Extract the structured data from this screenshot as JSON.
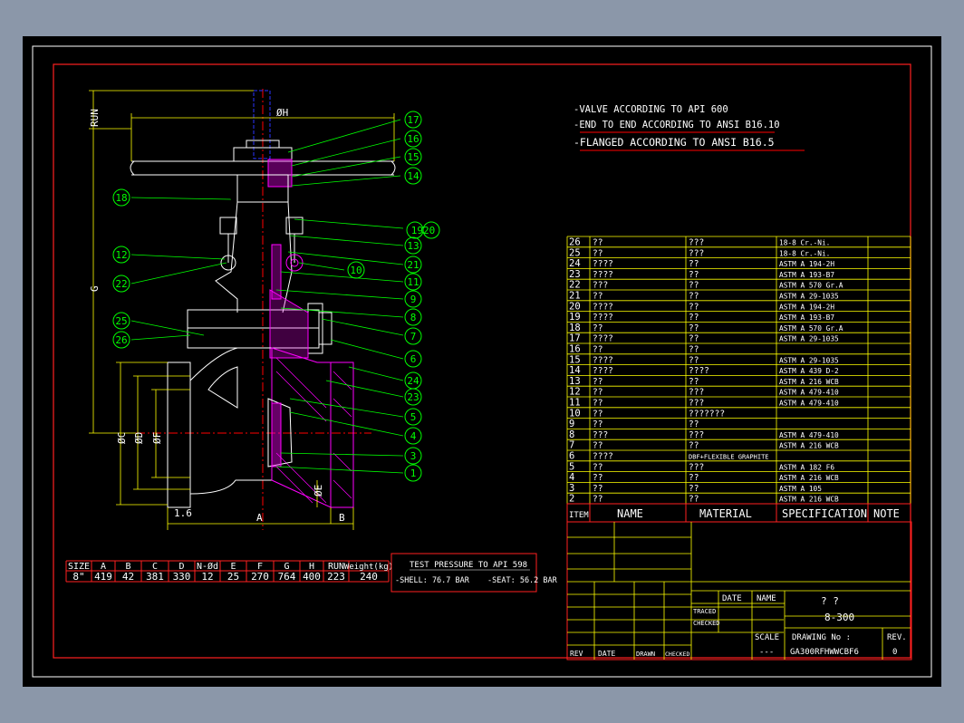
{
  "colors": {
    "outer_bg": "#8b97a9",
    "sheet_bg": "#000000",
    "border": "#ff2020",
    "frame": "#ffffff",
    "text": "#ffffff",
    "yellow": "#ffff00",
    "green": "#00ff00",
    "red": "#ff0000",
    "magenta": "#ff00ff",
    "blue": "#2b33ff"
  },
  "notes": [
    "-VALVE ACCORDING TO API 600",
    "-END TO END ACCORDING TO ANSI B16.10",
    "-FLANGED ACCORDING TO ANSI B16.5"
  ],
  "dims": {
    "run": "RUN",
    "oh": "ØH",
    "g": "G",
    "oc": "ØC",
    "od": "ØD",
    "of": "ØF",
    "oe": "ØE",
    "a": "A",
    "b": "B",
    "t": "1.6"
  },
  "balloons": [
    "17",
    "16",
    "15",
    "14",
    "18",
    "1920",
    "13",
    "12",
    "21",
    "10",
    "11",
    "22",
    "9",
    "8",
    "25",
    "7",
    "26",
    "6",
    "24",
    "23",
    "5",
    "4",
    "3",
    "1"
  ],
  "size_table": {
    "headers": [
      "SIZE",
      "A",
      "B",
      "C",
      "D",
      "N-Ød",
      "E",
      "F",
      "G",
      "H",
      "RUN",
      "Weight(kg)"
    ],
    "values": [
      "8\"",
      "419",
      "42",
      "381",
      "330",
      "12",
      "25",
      "270",
      "764",
      "400",
      "223",
      "240"
    ]
  },
  "test": {
    "title": "TEST PRESSURE TO API 598",
    "shell": "-SHELL: 76.7 BAR",
    "seat": "-SEAT: 56.2 BAR"
  },
  "parts": [
    [
      "26",
      "??",
      "???",
      "18-8 Cr.-Ni.",
      ""
    ],
    [
      "25",
      "??",
      "???",
      "18-8 Cr.-Ni.",
      ""
    ],
    [
      "24",
      "????",
      "??",
      "ASTM A 194-2H",
      ""
    ],
    [
      "23",
      "????",
      "??",
      "ASTM A 193-B7",
      ""
    ],
    [
      "22",
      "???",
      "??",
      "ASTM A 570 Gr.A",
      ""
    ],
    [
      "21",
      "??",
      "??",
      "ASTM A 29-1035",
      ""
    ],
    [
      "20",
      "????",
      "??",
      "ASTM A 194-2H",
      ""
    ],
    [
      "19",
      "????",
      "??",
      "ASTM A 193-B7",
      ""
    ],
    [
      "18",
      "??",
      "??",
      "ASTM A 570 Gr.A",
      ""
    ],
    [
      "17",
      "????",
      "??",
      "ASTM A 29-1035",
      ""
    ],
    [
      "16",
      "??",
      "??",
      "",
      ""
    ],
    [
      "15",
      "????",
      "??",
      "ASTM A 29-1035",
      ""
    ],
    [
      "14",
      "????",
      "????",
      "ASTM A 439 D-2",
      ""
    ],
    [
      "13",
      "??",
      "??",
      "ASTM A 216 WCB",
      ""
    ],
    [
      "12",
      "??",
      "???",
      "ASTM A 479-410",
      ""
    ],
    [
      "11",
      "??",
      "???",
      "ASTM A 479-410",
      ""
    ],
    [
      "10",
      "??",
      "???????",
      "",
      ""
    ],
    [
      "9",
      "??",
      "??",
      "",
      ""
    ],
    [
      "8",
      "???",
      "???",
      "ASTM A 479-410",
      ""
    ],
    [
      "7",
      "??",
      "??",
      "ASTM A 216 WCB",
      ""
    ],
    [
      "6",
      "????",
      "DBF+FLEXIBLE GRAPHITE",
      "",
      ""
    ],
    [
      "5",
      "??",
      "???",
      "ASTM A 182 F6",
      ""
    ],
    [
      "4",
      "??",
      "??",
      "ASTM A 216 WCB",
      ""
    ],
    [
      "3",
      "??",
      "??",
      "ASTM A 105",
      ""
    ],
    [
      "2",
      "??",
      "??",
      "ASTM A 216 WCB",
      ""
    ]
  ],
  "parts_header": {
    "item": "ITEM",
    "name": "NAME",
    "material": "MATERIAL",
    "spec": "SPECIFICATION",
    "note": "NOTE"
  },
  "title_block": {
    "date": "DATE",
    "name": "NAME",
    "traced": "TRACED",
    "checked": "CHECKED",
    "title_q": "?   ?",
    "class": "8-300",
    "scale_label": "SCALE",
    "scale_value": "---",
    "drawing_label": "DRAWING No :",
    "drawing_no": "GA300RFHWWCBF6",
    "rev_label": "REV.",
    "rev_value": "0",
    "rev_cols": [
      "REV",
      "DATE",
      "DRAWN",
      "CHECKED"
    ]
  }
}
